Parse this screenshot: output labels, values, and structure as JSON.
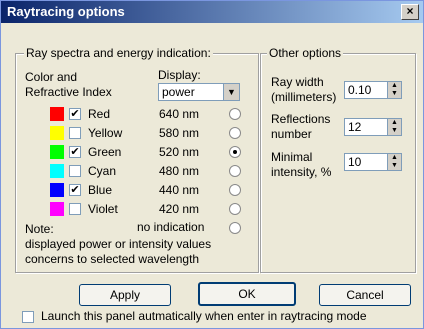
{
  "window": {
    "title": "Raytracing options",
    "close_glyph": "×"
  },
  "left_group": {
    "legend": "Ray spectra and energy indication:",
    "color_label_1": "Color and",
    "color_label_2": "Refractive Index",
    "display_label": "Display:",
    "display_value": "power",
    "dropdown_glyph": "▼",
    "colors": [
      {
        "name": "Red",
        "wavelength": "640 nm",
        "checked": true,
        "selected": false,
        "swatch": "#ff0000"
      },
      {
        "name": "Yellow",
        "wavelength": "580 nm",
        "checked": false,
        "selected": false,
        "swatch": "#ffff00"
      },
      {
        "name": "Green",
        "wavelength": "520 nm",
        "checked": true,
        "selected": true,
        "swatch": "#00ff00"
      },
      {
        "name": "Cyan",
        "wavelength": "480 nm",
        "checked": false,
        "selected": false,
        "swatch": "#00ffff"
      },
      {
        "name": "Blue",
        "wavelength": "440 nm",
        "checked": true,
        "selected": false,
        "swatch": "#0000ff"
      },
      {
        "name": "Violet",
        "wavelength": "420 nm",
        "checked": false,
        "selected": false,
        "swatch": "#ff00ff"
      }
    ],
    "no_indication": "no indication",
    "note": "Note:",
    "note_line1": "displayed power or intensity values",
    "note_line2": "concerns to selected wavelength"
  },
  "right_group": {
    "legend": "Other options",
    "ray_width_label_1": "Ray width",
    "ray_width_label_2": "(millimeters)",
    "ray_width_value": "0.10",
    "reflections_label_1": "Reflections",
    "reflections_label_2": "number",
    "reflections_value": "12",
    "minimal_label_1": "Minimal",
    "minimal_label_2": "intensity, %",
    "minimal_value": "10",
    "spin_up": "▲",
    "spin_down": "▼"
  },
  "buttons": {
    "apply": "Apply",
    "ok": "OK",
    "cancel": "Cancel"
  },
  "footer": {
    "launch_label": "Launch this panel autmatically when enter in raytracing mode",
    "launch_checked": false
  },
  "check_glyph": "✔"
}
